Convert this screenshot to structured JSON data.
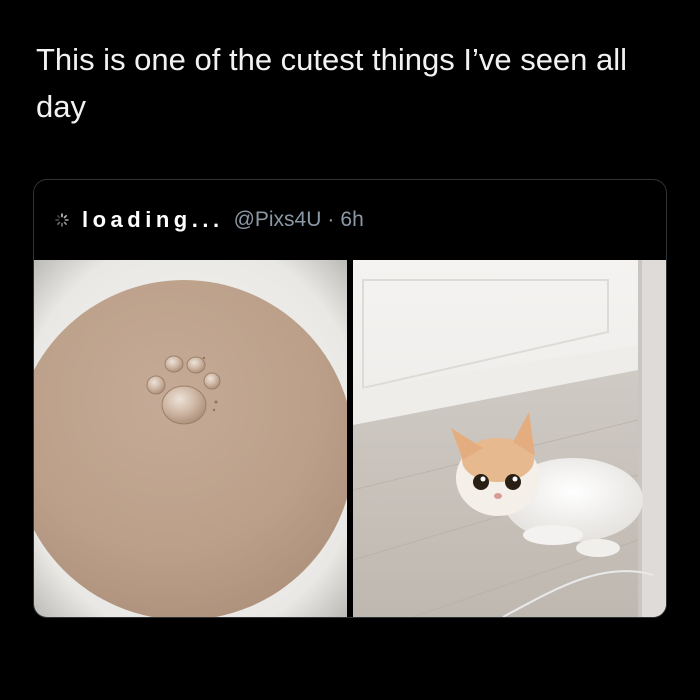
{
  "post": {
    "text": "This is one of the cutest things I’ve seen all day"
  },
  "quoted_tweet": {
    "avatar_icon": "loading-spinner-icon",
    "display_name": "loading...",
    "handle": "@Pixs4U",
    "separator": "·",
    "timestamp": "6h",
    "media": [
      {
        "icon": "milk-tea-cup-with-paw-bubble-image"
      },
      {
        "icon": "kitten-lying-on-floor-image"
      }
    ]
  },
  "colors": {
    "background": "#000000",
    "text": "#f2f2f2",
    "secondary_text": "#8b98a5",
    "card_border": "#2f3336"
  }
}
